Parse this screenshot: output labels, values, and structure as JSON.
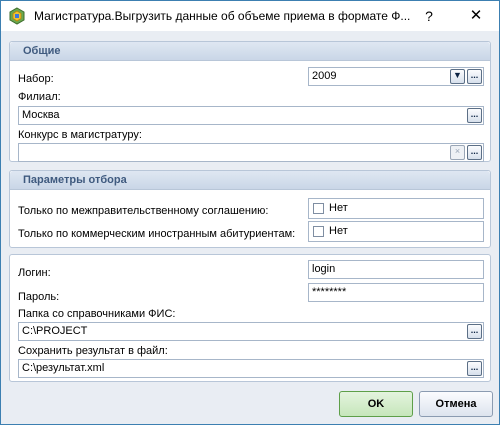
{
  "window": {
    "title": "Магистратура.Выгрузить данные об объеме приема в формате Ф...",
    "help": "?",
    "close": "✕"
  },
  "general": {
    "header": "Общие",
    "set_label": "Набор:",
    "set_value": "2009",
    "branch_label": "Филиал:",
    "branch_value": "Москва",
    "contest_label": "Конкурс в магистратуру:",
    "contest_value": ""
  },
  "filters": {
    "header": "Параметры отбора",
    "intergov_label": "Только по межправительственному соглашению:",
    "intergov_value": "Нет",
    "commercial_label": "Только по коммерческим иностранным абитуриентам:",
    "commercial_value": "Нет"
  },
  "credentials": {
    "login_label": "Логин:",
    "login_value": "login",
    "password_label": "Пароль:",
    "password_value": "********",
    "fis_folder_label": "Папка со справочниками ФИС:",
    "fis_folder_value": "C:\\PROJECT",
    "save_file_label": "Сохранить результат в файл:",
    "save_file_value": "C:\\результат.xml"
  },
  "buttons": {
    "ellipsis": "...",
    "dropdown": "▼",
    "clear": "×",
    "ok": "OK",
    "cancel": "Отмена"
  }
}
